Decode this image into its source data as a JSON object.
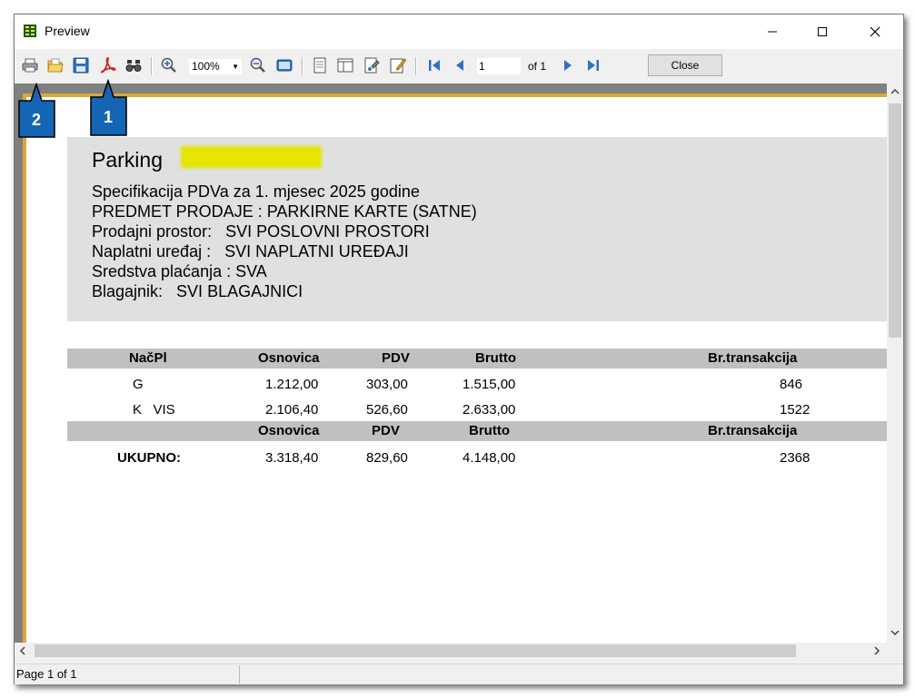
{
  "window": {
    "title": "Preview"
  },
  "toolbar": {
    "zoom_value": "100%",
    "page_value": "1",
    "of_label": "of 1",
    "close_label": "Close"
  },
  "callouts": {
    "one": "1",
    "two": "2"
  },
  "report": {
    "title": "Parking",
    "lines": [
      "Specifikacija PDVa za 1. mjesec 2025 godine",
      "PREDMET PRODAJE : PARKIRNE KARTE (SATNE)",
      "Prodajni prostor:   SVI POSLOVNI PROSTORI",
      "Naplatni uređaj :   SVI NAPLATNI UREĐAJI",
      "Sredstva plaćanja : SVA",
      "Blagajnik:   SVI BLAGAJNICI"
    ],
    "table": {
      "headers": [
        "NačPl",
        "Osnovica",
        "PDV",
        "Brutto",
        "Br.transakcija"
      ],
      "rows": [
        [
          "G",
          "1.212,00",
          "303,00",
          "1.515,00",
          "846"
        ],
        [
          "K   VIS",
          "2.106,40",
          "526,60",
          "2.633,00",
          "1522"
        ]
      ],
      "total_headers": [
        "Osnovica",
        "PDV",
        "Brutto",
        "Br.transakcija"
      ],
      "total_label": "UKUPNO:",
      "totals": [
        "3.318,40",
        "829,60",
        "4.148,00",
        "2368"
      ]
    }
  },
  "statusbar": {
    "text": "Page 1 of 1"
  },
  "icons": [
    "app-icon",
    "minimize-icon",
    "maximize-icon",
    "close-icon",
    "print-icon",
    "open-icon",
    "save-icon",
    "pdf-icon",
    "find-icon",
    "zoom-in-icon",
    "zoom-out-icon",
    "fullscreen-icon",
    "single-page-icon",
    "multi-page-icon",
    "page-setup-icon",
    "edit-icon",
    "first-page-icon",
    "prev-page-icon",
    "next-page-icon",
    "last-page-icon",
    "scroll-up-icon",
    "scroll-down-icon",
    "scroll-left-icon",
    "scroll-right-icon"
  ],
  "colors": {
    "callout": "#1565b5",
    "header_bg": "#e0e0e0",
    "table_header_bg": "#c0c0c0",
    "page_border_gold": "#d8a83c",
    "highlight_yellow": "#e5e500"
  }
}
